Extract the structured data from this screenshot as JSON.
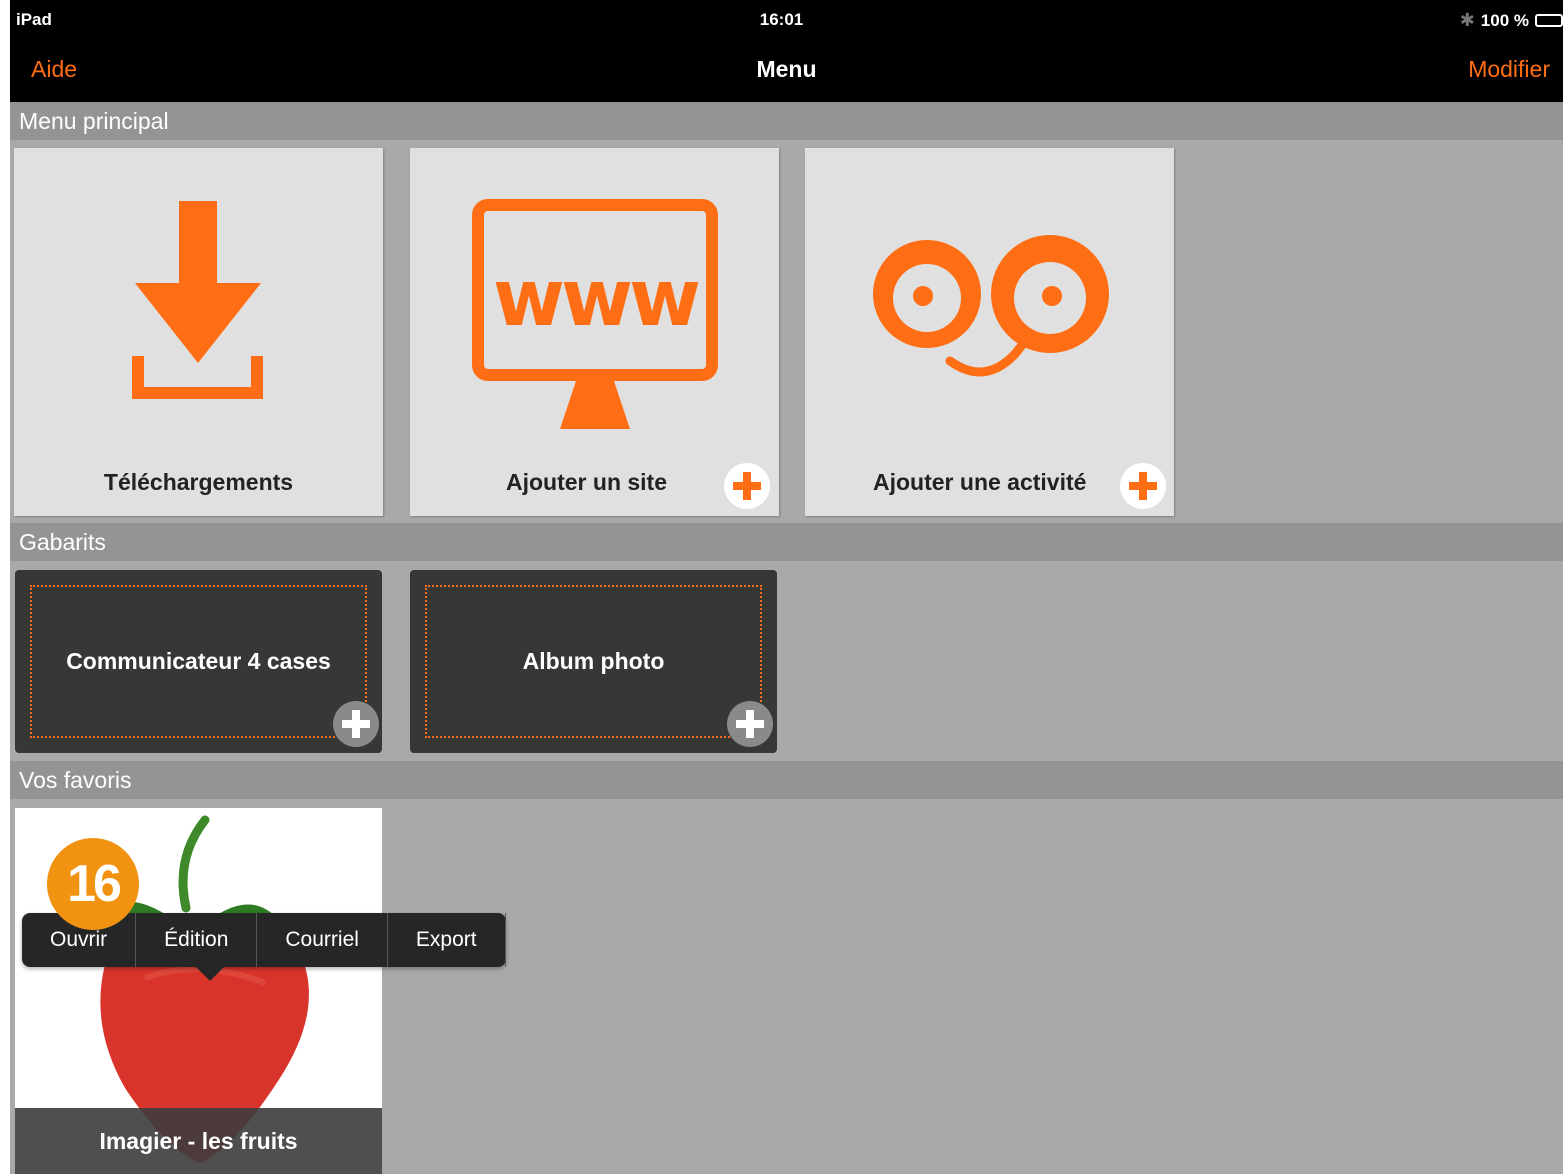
{
  "status_bar": {
    "carrier": "iPad",
    "time": "16:01",
    "battery_text": "100 %",
    "bluetooth_icon": "bluetooth-icon",
    "battery_icon": "battery-icon",
    "battery_level": 1.0
  },
  "nav_bar": {
    "left_button": "Aide",
    "title": "Menu",
    "right_button": "Modifier"
  },
  "sections": {
    "main": {
      "title": "Menu principal",
      "tiles": [
        {
          "label": "Téléchargements",
          "icon": "download-icon"
        },
        {
          "label": "Ajouter un site",
          "icon": "www-monitor-icon",
          "badge": "plus-icon"
        },
        {
          "label": "Ajouter une activité",
          "icon": "eyes-face-icon",
          "badge": "plus-icon"
        }
      ]
    },
    "templates": {
      "title": "Gabarits",
      "tiles": [
        {
          "label": "Communicateur 4 cases",
          "badge": "plus-icon"
        },
        {
          "label": "Album photo",
          "badge": "plus-icon"
        }
      ]
    },
    "favorites": {
      "title": "Vos favoris",
      "tiles": [
        {
          "label": "Imagier - les fruits",
          "image": "strawberry"
        }
      ]
    }
  },
  "step_badge": "16",
  "context_menu": {
    "items": [
      "Ouvrir",
      "Édition",
      "Courriel",
      "Export"
    ]
  },
  "colors": {
    "accent": "#ff6e14",
    "step_badge": "#f29211",
    "background": "#a9a9a9",
    "section_header": "#949494"
  }
}
